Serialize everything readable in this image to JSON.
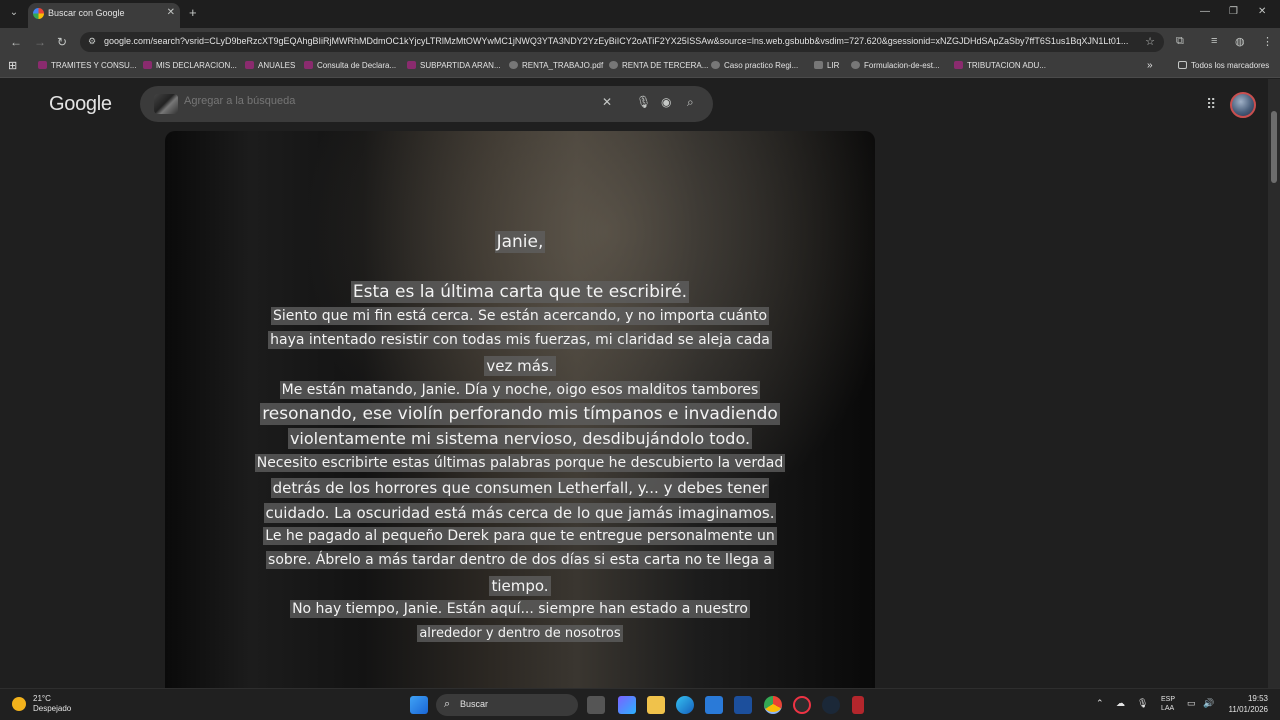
{
  "browser": {
    "tab_title": "Buscar con Google",
    "url": "google.com/search?vsrid=CLyD9beRzcXT9gEQAhgBIiRjMWRhMDdmOC1kYjcyLTRlMzMtOWYwMC1jNWQ3YTA3NDY2YzEyBiICY2oATiF2YX25ISSAw&source=lns.web.gsbubb&vsdim=727.620&gsessionid=xNZGJDHdSApZaSby7ffT6S1us1BqXJN1Lt01..."
  },
  "bookmarks": {
    "items": [
      "TRAMITES Y CONSU...",
      "MIS DECLARACION...",
      "ANUALES",
      "Consulta de Declara...",
      "SUBPARTIDA ARAN...",
      "RENTA_TRABAJO.pdf",
      "RENTA DE TERCERA...",
      "Caso practico Regi...",
      "LIR",
      "Formulacion-de-est...",
      "TRIBUTACION ADU..."
    ],
    "all_bookmarks": "Todos los marcadores"
  },
  "google": {
    "logo": "Google",
    "search_placeholder": "Agregar a la búsqueda"
  },
  "letter": {
    "greeting": "Janie,",
    "lines": [
      "Esta es la última carta que te escribiré.",
      "Siento que mi fin está cerca. Se están acercando, y no importa cuánto",
      "haya intentado resistir con todas mis fuerzas, mi claridad se aleja cada",
      "vez más.",
      "Me están matando, Janie. Día y noche, oigo esos malditos tambores",
      "resonando, ese violín perforando mis tímpanos e invadiendo",
      "violentamente mi sistema nervioso, desdibujándolo todo.",
      "Necesito escribirte estas últimas palabras porque he descubierto la verdad",
      "detrás de los horrores que consumen Letherfall, y... y debes tener",
      "cuidado. La oscuridad está más cerca de lo que jamás imaginamos.",
      "Le he pagado al pequeño Derek para que te entregue personalmente un",
      "sobre. Ábrelo a más tardar dentro de dos días si esta carta no te llega a",
      "tiempo.",
      "No hay tiempo, Janie. Están aquí... siempre han estado a nuestro",
      "alrededor y dentro de nosotros"
    ]
  },
  "taskbar": {
    "temperature": "21°C",
    "weather": "Despejado",
    "search_label": "Buscar",
    "language": "ESP",
    "layout": "LAA",
    "time": "19:53",
    "date": "11/01/2026"
  }
}
